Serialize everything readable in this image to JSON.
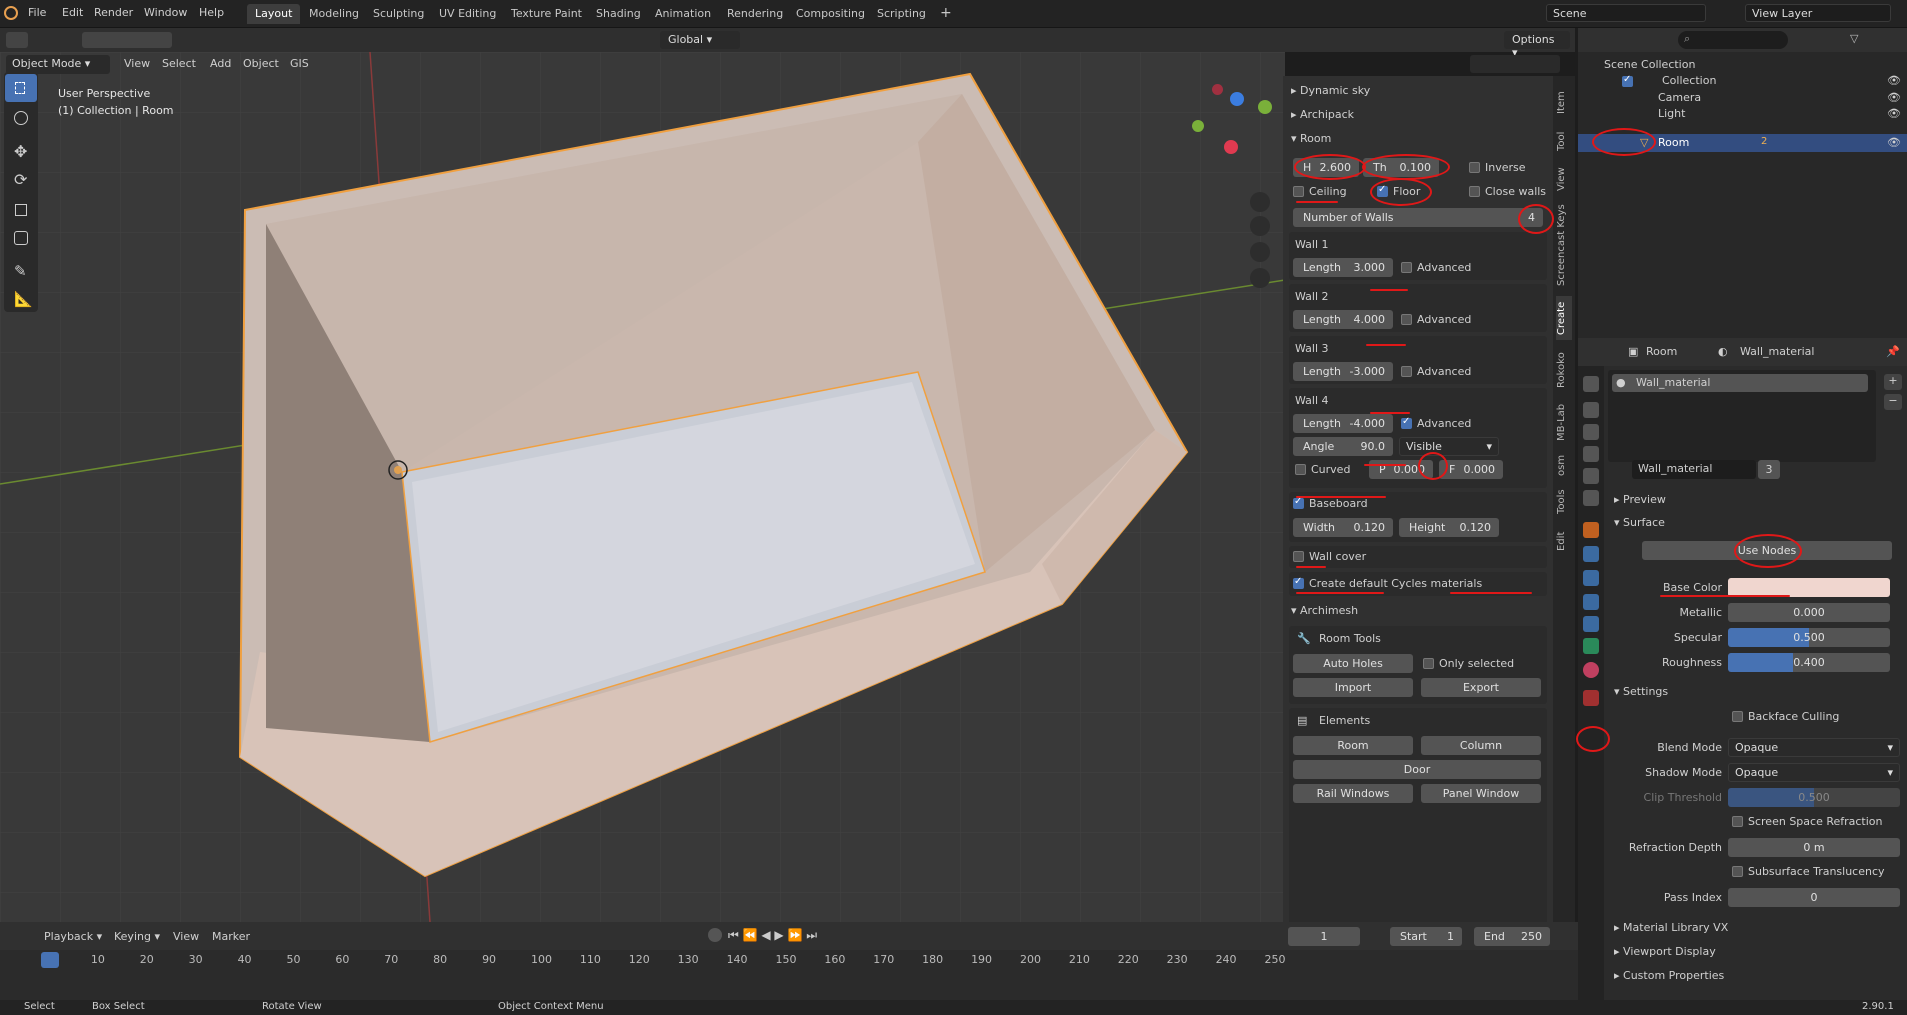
{
  "topbar": {
    "menus": [
      "File",
      "Edit",
      "Render",
      "Window",
      "Help"
    ],
    "workspaces": [
      "Layout",
      "Modeling",
      "Sculpting",
      "UV Editing",
      "Texture Paint",
      "Shading",
      "Animation",
      "Rendering",
      "Compositing",
      "Scripting"
    ],
    "plus": "+",
    "scene": "Scene",
    "view_layer": "View Layer"
  },
  "viewport_header": {
    "mode": "Object Mode",
    "menus": [
      "View",
      "Select",
      "Add",
      "Object",
      "GIS"
    ],
    "transform": "Global",
    "options": "Options"
  },
  "viewport": {
    "perspective": "User Perspective",
    "collection": "(1) Collection | Room"
  },
  "npanel": {
    "dynamic_sky": "Dynamic sky",
    "archipack": "Archipack",
    "room": "Room",
    "h_label": "H",
    "h_value": "2.600",
    "th_label": "Th",
    "th_value": "0.100",
    "inverse": "Inverse",
    "ceiling": "Ceiling",
    "floor": "Floor",
    "close_walls": "Close walls",
    "number_of_walls_label": "Number of Walls",
    "number_of_walls": "4",
    "length_label": "Length",
    "advanced": "Advanced",
    "walls": [
      {
        "title": "Wall 1",
        "length": "3.000"
      },
      {
        "title": "Wall 2",
        "length": "4.000"
      },
      {
        "title": "Wall 3",
        "length": "-3.000"
      },
      {
        "title": "Wall 4",
        "length": "-4.000"
      }
    ],
    "angle_label": "Angle",
    "angle_value": "90.0",
    "visible": "Visible",
    "curved": "Curved",
    "p_label": "P",
    "p_value": "0.000",
    "f_label": "F",
    "f_value": "0.000",
    "baseboard": "Baseboard",
    "width_label": "Width",
    "width_value": "0.120",
    "height_label": "Height",
    "height_value": "0.120",
    "wall_cover": "Wall cover",
    "cycles": "Create default Cycles materials",
    "archimesh": "Archimesh",
    "room_tools": "Room Tools",
    "auto_holes": "Auto Holes",
    "only_selected": "Only selected",
    "import": "Import",
    "export": "Export",
    "elements": "Elements",
    "room_btn": "Room",
    "column_btn": "Column",
    "door_btn": "Door",
    "rail_windows": "Rail Windows",
    "panel_window": "Panel Window"
  },
  "vtabs": [
    "Item",
    "Tool",
    "View",
    "Screencast Keys",
    "Create",
    "Rokoko",
    "MB-Lab",
    "osm",
    "Tools",
    "Edit"
  ],
  "outliner": {
    "scene_collection": "Scene Collection",
    "collection": "Collection",
    "camera": "Camera",
    "light": "Light",
    "room": "Room",
    "badge": "2"
  },
  "properties": {
    "object": "Room",
    "material_tab": "Wall_material",
    "slot": "Wall_material",
    "material_name": "Wall_material",
    "users": "3",
    "preview": "Preview",
    "surface": "Surface",
    "use_nodes": "Use Nodes",
    "base_color_label": "Base Color",
    "metallic_label": "Metallic",
    "metallic": "0.000",
    "specular_label": "Specular",
    "specular": "0.500",
    "roughness_label": "Roughness",
    "roughness": "0.400",
    "settings": "Settings",
    "backface_culling": "Backface Culling",
    "blend_mode_label": "Blend Mode",
    "blend_mode": "Opaque",
    "shadow_mode_label": "Shadow Mode",
    "shadow_mode": "Opaque",
    "clip_threshold_label": "Clip Threshold",
    "clip_threshold": "0.500",
    "ssr": "Screen Space Refraction",
    "refraction_depth_label": "Refraction Depth",
    "refraction_depth": "0 m",
    "sss": "Subsurface Translucency",
    "pass_index_label": "Pass Index",
    "pass_index": "0",
    "material_library": "Material Library VX",
    "viewport_display": "Viewport Display",
    "custom_properties": "Custom Properties"
  },
  "timeline": {
    "playback": "Playback",
    "keying": "Keying",
    "view": "View",
    "marker": "Marker",
    "current_frame": "1",
    "start_label": "Start",
    "start": "1",
    "end_label": "End",
    "end": "250",
    "ticks": [
      "1",
      "10",
      "20",
      "30",
      "40",
      "50",
      "60",
      "70",
      "80",
      "90",
      "100",
      "110",
      "120",
      "130",
      "140",
      "150",
      "160",
      "170",
      "180",
      "190",
      "200",
      "210",
      "220",
      "230",
      "240",
      "250"
    ]
  },
  "statusbar": {
    "select": "Select",
    "box_select": "Box Select",
    "rotate_view": "Rotate View",
    "context_menu": "Object Context Menu",
    "version": "2.90.1"
  },
  "colors": {
    "accent": "#4772b3",
    "selected_row": "#334d80",
    "annotation": "#e01818",
    "base_color": "#f0d6cf",
    "room_selection": "#f0a040"
  }
}
